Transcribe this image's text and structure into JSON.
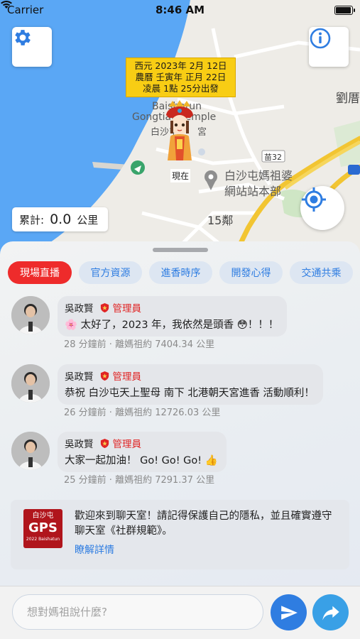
{
  "status_bar": {
    "carrier": "Carrier",
    "time": "8:46 AM"
  },
  "map": {
    "info_bubble": [
      "西元 2023年 2月 12日",
      "農曆 壬寅年 正月 22日",
      "凌晨 1點 25分出發"
    ],
    "places": {
      "temple_en": "Baishatun",
      "temple_en2": "Gongtian Temple",
      "temple_zh_partial": "白沙屯",
      "temple_zh_partial2": "宮",
      "station_line1": "白沙屯媽祖婆",
      "station_line2": "網站站本部",
      "now_label": "現在",
      "district": "15鄰",
      "town": "劉厝",
      "road_badge": "苗32"
    },
    "counter": {
      "label": "累計:",
      "value": "0.0",
      "unit": "公里"
    },
    "colors": {
      "water": "#5aa7f5",
      "road": "#f6cf3a",
      "accent": "#2f7de1"
    }
  },
  "tabs": [
    {
      "label": "現場直播",
      "active": true
    },
    {
      "label": "官方資源",
      "active": false
    },
    {
      "label": "進香時序",
      "active": false
    },
    {
      "label": "開發心得",
      "active": false
    },
    {
      "label": "交通共乘",
      "active": false
    }
  ],
  "messages": [
    {
      "name": "吳政賢",
      "role": "管理員",
      "text": "🌸 太好了，2023 年，我依然是頭香 😳！！！",
      "meta": "28 分鐘前 · 離媽祖約 7404.34 公里"
    },
    {
      "name": "吳政賢",
      "role": "管理員",
      "text": "恭祝 白沙屯天上聖母 南下 北港朝天宮進香 活動順利！",
      "meta": "26 分鐘前 · 離媽祖約 12726.03 公里"
    },
    {
      "name": "吳政賢",
      "role": "管理員",
      "text": "大家一起加油！ Go! Go! Go! 👍",
      "meta": "25 分鐘前 · 離媽祖約 7291.37 公里"
    }
  ],
  "notice": {
    "logo_top": "白沙屯",
    "logo_main": "GPS",
    "logo_sub": "2022 Baishatun",
    "text": "歡迎來到聊天室！請記得保護自己的隱私，並且確實遵守聊天室《社群規範》。",
    "link": "瞭解詳情"
  },
  "composer": {
    "placeholder": "想對媽祖說什麼?"
  }
}
